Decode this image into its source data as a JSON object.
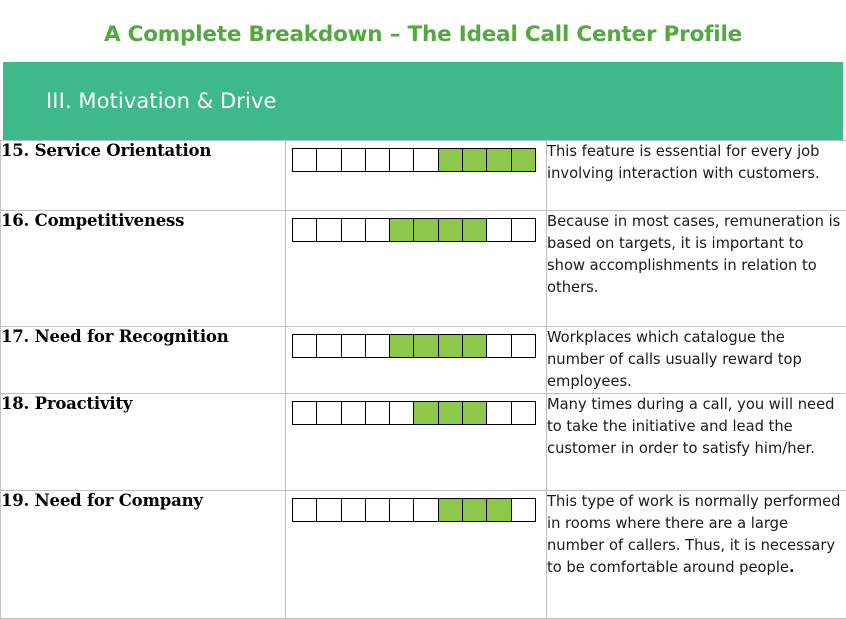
{
  "slide": {
    "title": "A Complete Breakdown – The Ideal Call Center Profile",
    "section_header": "III. Motivation & Drive",
    "colors": {
      "title_green": "#53A93F",
      "band_green": "#3EB98A",
      "filled_box_green": "#8DC84B",
      "grid_gray": "#bfbfbf",
      "box_outline": "#000000"
    }
  },
  "scale": {
    "total_boxes": 10
  },
  "rows": [
    {
      "label": "15. Service Orientation",
      "filled_from": 7,
      "filled_to": 10,
      "filled_count": 4,
      "description": "This feature is essential for every job involving interaction with customers."
    },
    {
      "label": "16. Competitiveness",
      "filled_from": 5,
      "filled_to": 8,
      "filled_count": 4,
      "description": "Because in most cases, remuneration is based on targets, it is important to show accomplishments in relation to others."
    },
    {
      "label": "17. Need for Recognition",
      "filled_from": 5,
      "filled_to": 8,
      "filled_count": 4,
      "description": "Workplaces which catalogue the number of calls usually reward top employees."
    },
    {
      "label": "18. Proactivity",
      "filled_from": 6,
      "filled_to": 8,
      "filled_count": 3,
      "description": "Many times during a call, you will need to take the initiative and lead the customer in order to satisfy him/her."
    },
    {
      "label": "19. Need for Company",
      "filled_from": 7,
      "filled_to": 9,
      "filled_count": 3,
      "description": "This type of work is normally performed in rooms where there are a large number of callers. Thus, it is necessary to be comfortable around people."
    }
  ]
}
